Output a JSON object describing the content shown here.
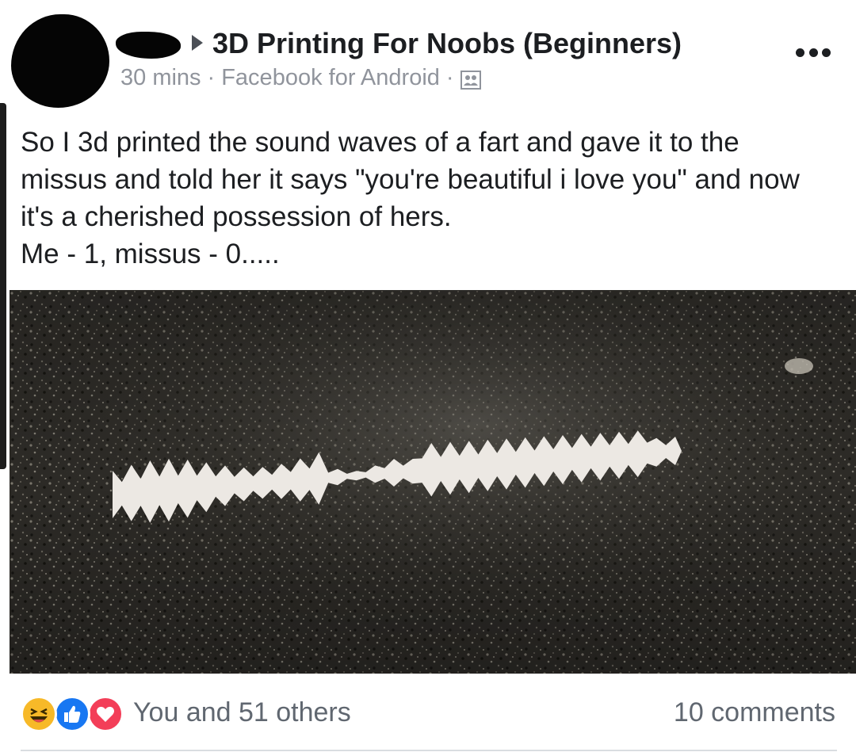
{
  "post": {
    "group_name": "3D Printing For Noobs (Beginners)",
    "time": "30 mins",
    "separator": "·",
    "source": "Facebook for Android",
    "audience_icon": "group-audience-icon",
    "text_lines": [
      "So I 3d printed the sound waves of a fart and gave it to the",
      "missus and told her it says \"you're beautiful i love you\" and now",
      "it's a cherished possession of hers.",
      "Me - 1, missus - 0....."
    ]
  },
  "footer": {
    "reactions_text": "You and 51 others",
    "comments_text": "10 comments",
    "reaction_icons": [
      "haha-icon",
      "like-icon",
      "love-icon"
    ]
  },
  "colors": {
    "text": "#1c1e21",
    "meta": "#90949c",
    "like_blue": "#1877f2",
    "love_red": "#f33e58",
    "haha_yellow": "#f7b928"
  }
}
